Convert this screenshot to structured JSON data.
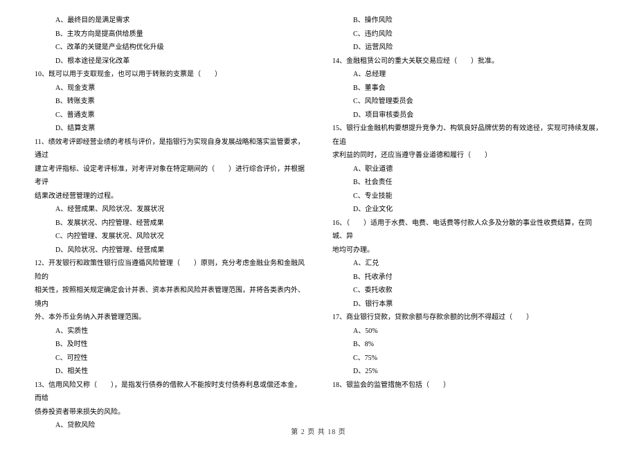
{
  "left": {
    "q9_opts": {
      "a": "A、最终目的是满足需求",
      "b": "B、主攻方向是提高供给质量",
      "c": "C、改革的关键是产业结构优化升级",
      "d": "D、根本途径是深化改革"
    },
    "q10": "10、既可以用于支取现金，也可以用于转账的支票是（　　）",
    "q10_opts": {
      "a": "A、现金支票",
      "b": "B、转账支票",
      "c": "C、普通支票",
      "d": "D、结算支票"
    },
    "q11_l1": "11、绩效考评即经营业绩的考核与评价，是指银行为实现自身发展战略和落实监管要求，通过",
    "q11_l2": "建立考评指标、设定考评标准，对考评对象在特定期间的（　　）进行综合评价，并根据考评",
    "q11_l3": "结果改进经营管理的过程。",
    "q11_opts": {
      "a": "A、经营成果、风险状况、发展状况",
      "b": "B、发展状况、内控管理、经营成果",
      "c": "C、内控管理、发展状况、风险状况",
      "d": "D、风险状况、内控管理、经营成果"
    },
    "q12_l1": "12、开发银行和政策性银行应当遵循风险管理（　　）原则，充分考虑金融业务和金融风险的",
    "q12_l2": "相关性，按照相关规定确定会计并表、资本并表和风险并表管理范围，并将各类表内外、境内",
    "q12_l3": "外、本外币业务纳入并表管理范围。",
    "q12_opts": {
      "a": "A、实质性",
      "b": "B、及时性",
      "c": "C、可控性",
      "d": "D、相关性"
    },
    "q13_l1": "13、信用风险又称（　　），是指发行债券的借款人不能按时支付债券利息或偿还本金，而给",
    "q13_l2": "债券投资者带来损失的风险。",
    "q13_opts": {
      "a": "A、贷款风险"
    }
  },
  "right": {
    "q13_opts": {
      "b": "B、操作风险",
      "c": "C、违约风险",
      "d": "D、运营风险"
    },
    "q14": "14、金融租赁公司的重大关联交易应经（　　）批准。",
    "q14_opts": {
      "a": "A、总经理",
      "b": "B、董事会",
      "c": "C、风险管理委员会",
      "d": "D、项目审核委员会"
    },
    "q15_l1": "15、银行业金融机构要想提升竞争力、构筑良好品牌优势的有效途径，实现可持续发展，在追",
    "q15_l2": "求利益的同时，还应当遵守善业道德和履行（　　）",
    "q15_opts": {
      "a": "A、职业道德",
      "b": "B、社会责任",
      "c": "C、专业技能",
      "d": "D、企业文化"
    },
    "q16_l1": "16、（　　）适用于水费、电费、电话费等付款人众多及分散的事业性收费结算，在同城、异",
    "q16_l2": "地均可办理。",
    "q16_opts": {
      "a": "A、汇兑",
      "b": "B、托收承付",
      "c": "C、委托收款",
      "d": "D、银行本票"
    },
    "q17": "17、商业银行贷款，贷款余额与存款余额的比例不得超过（　　）",
    "q17_opts": {
      "a": "A、50%",
      "b": "B、8%",
      "c": "C、75%",
      "d": "D、25%"
    },
    "q18": "18、银监会的监管措施不包括（　　）"
  },
  "footer": "第 2 页 共 18 页"
}
